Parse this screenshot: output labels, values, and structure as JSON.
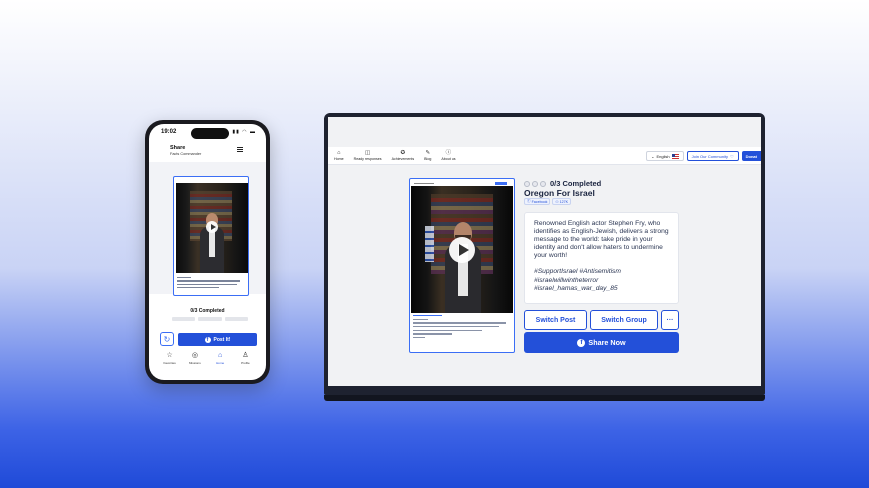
{
  "phone": {
    "status_time": "19:02",
    "status_icons": "▮▮ ◠ ▬",
    "header_title": "Share",
    "header_subtitle": "Facts Commander",
    "completed_text": "0/3 Completed",
    "post_button": "Post It!",
    "refresh_icon": "↻",
    "tabs": [
      {
        "icon": "☆",
        "label": "Favorites"
      },
      {
        "icon": "◎",
        "label": "Missions"
      },
      {
        "icon": "⌂",
        "label": "Home"
      },
      {
        "icon": "♙",
        "label": "Profile"
      }
    ]
  },
  "laptop": {
    "nav": [
      {
        "icon": "⌂",
        "label": "Home"
      },
      {
        "icon": "◫",
        "label": "Ready responses"
      },
      {
        "icon": "✪",
        "label": "Achievements"
      },
      {
        "icon": "✎",
        "label": "Blog"
      },
      {
        "icon": "ⓘ",
        "label": "About us"
      }
    ],
    "language": "English",
    "join_label": "Join Our Community",
    "donate_label": "Donat",
    "progress_text": "0/3 Completed",
    "group_name": "Oregon For Israel",
    "tags": [
      "Facebook",
      "127K"
    ],
    "post_text": "Renowned English actor Stephen Fry, who identifies as English-Jewish, delivers a strong message to the world: take pride in your identity and don't allow haters to undermine your worth!",
    "hashtags": "#SupportIsrael #Antisemitism #israelwillwintheterror #israel_hamas_war_day_85",
    "switch_post": "Switch Post",
    "switch_group": "Switch Group",
    "more": "···",
    "share_now": "Share Now"
  },
  "colors": {
    "accent": "#2350d9",
    "background_top": "#ffffff",
    "background_bottom": "#1f4ad8"
  }
}
